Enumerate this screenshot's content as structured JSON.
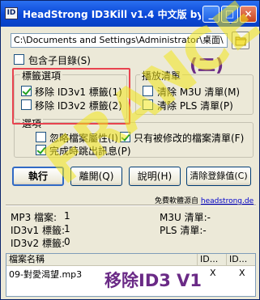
{
  "window": {
    "title": "HeadStrong ID3Kill v1.4 中文版 by ...",
    "icon_glyph": "ID",
    "controls": {
      "minimize": "_",
      "maximize": "□",
      "close": "×"
    }
  },
  "path": {
    "value": "C:\\Documents and Settings\\Administrator\\桌面\\"
  },
  "include_subdirs_label": "包含子目錄(S)",
  "tag_options": {
    "title": "標籤選項",
    "remove_v1": {
      "label": "移除 ID3v1 標籤(1)",
      "checked": true
    },
    "remove_v2": {
      "label": "移除 ID3v2 標籤(2)",
      "checked": false
    }
  },
  "playlist": {
    "title": "播放清單",
    "clear_m3u": "清除 M3U 清單(M)",
    "clear_pls": "清除 PLS 清單(P)"
  },
  "options": {
    "title": "選項",
    "ignore_attrs": "忽略檔案屬性(I)",
    "only_modified": "只有被修改的檔案清單(F)",
    "popup_on_finish": "完成時跳出訊息(P)"
  },
  "buttons": {
    "run": "執行",
    "exit": "離開(Q)",
    "help": "說明(H)",
    "clear_log": "清除登錄值(C)"
  },
  "footer": {
    "note": "免費軟體源自",
    "link": "headstrong.de"
  },
  "stats": {
    "mp3_files": "MP3 檔案:",
    "mp3_count": "1",
    "id3v1": "ID3v1 標籤:",
    "id3v1_count": "1",
    "id3v2": "ID3v2 標籤:",
    "id3v2_count": "0",
    "m3u": "M3U 清單:-",
    "pls": "PLS 清單:-"
  },
  "list": {
    "headers": [
      "檔案名稱",
      "ID...",
      "ID..."
    ],
    "rows": [
      {
        "name": "09-對愛渴望.mp3",
        "c1": "X",
        "c2": "X"
      }
    ]
  },
  "annotations": {
    "number": "(二)",
    "caption": "移除ID3 V1",
    "watermark": "FRANCE"
  },
  "colors": {
    "titlebar": "#0a48d8",
    "annotation_box": "#e8434f",
    "annotation_text": "#6a2a86",
    "watermark": "#f2e61c"
  }
}
